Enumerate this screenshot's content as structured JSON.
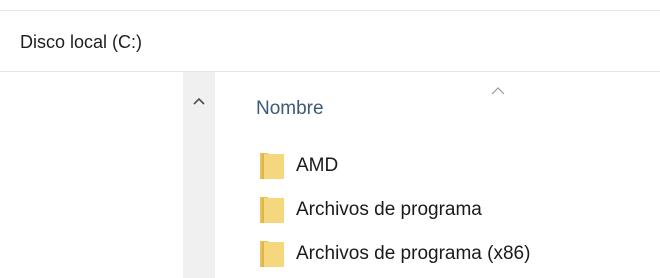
{
  "breadcrumb": {
    "label": "Disco local (C:)"
  },
  "columns": {
    "name_header": "Nombre"
  },
  "files": [
    {
      "name": "AMD",
      "icon": "folder-icon"
    },
    {
      "name": "Archivos de programa",
      "icon": "folder-icon"
    },
    {
      "name": "Archivos de programa (x86)",
      "icon": "folder-icon"
    }
  ],
  "colors": {
    "header_text": "#3c5a78",
    "folder_fill": "#f5d77e",
    "folder_back": "#e8c25a"
  }
}
